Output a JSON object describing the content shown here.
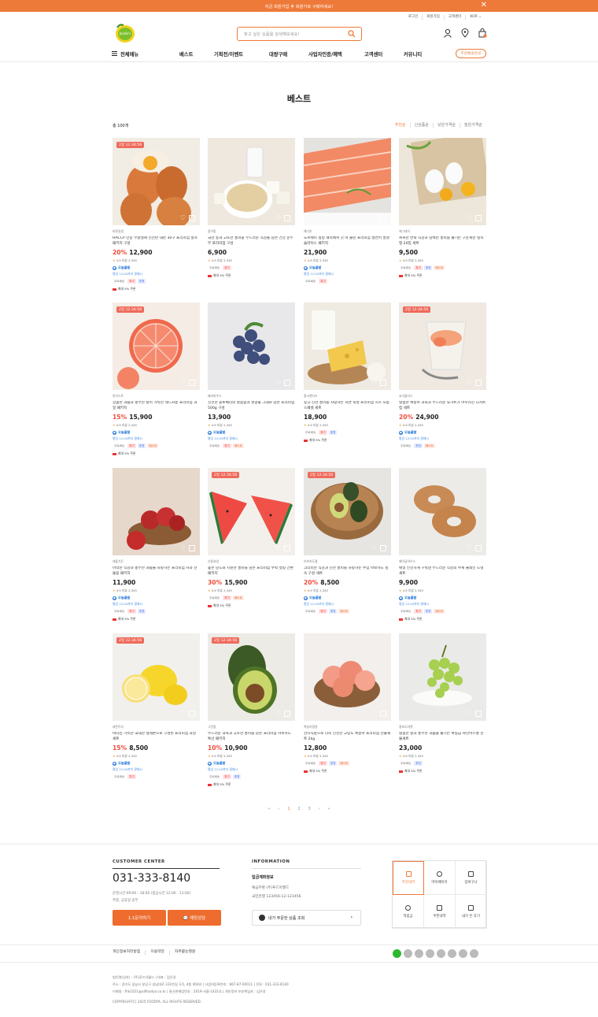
{
  "topbar": {
    "message": "지금 회원가입 후 회원가로 구매하세요!",
    "close": "✕"
  },
  "util": [
    "로그인",
    "회원가입",
    "고객센터",
    "KOR ⌄"
  ],
  "logo": {
    "text": "Jooda's Farm"
  },
  "search": {
    "placeholder": "찾고 싶은 상품을 검색해보세요!"
  },
  "nav": {
    "all_menu": "전체메뉴",
    "items": [
      "베스트",
      "기획전/이벤트",
      "대량구매",
      "사업자인증/혜택",
      "고객센터",
      "커뮤니티"
    ],
    "guide": "주문배송안내"
  },
  "page": {
    "title": "베스트",
    "count": "총 100개"
  },
  "sorts": [
    "추천순",
    "신상품순",
    "낮은가격순",
    "높은가격순"
  ],
  "labels": {
    "today": "오늘출발",
    "ship": "평일 12:00까지 결제시",
    "free": "무료배송",
    "special": "특가",
    "recommend": "추천",
    "best": "베스트",
    "coupon": "최대 5% 쿠폰"
  },
  "colors": {
    "accent": "#ee7a3a",
    "discount": "#ef4c3a",
    "timer": "#ef6a5b",
    "today": "#1e73d8"
  },
  "products": [
    {
      "timer": "2일 12:34:56",
      "brand": "바른달걀",
      "name": "HACCP 인증 무항생제 신선란 대란 30구 프리미엄 실속 패키지 구성",
      "discount": "20%",
      "price": "12,900",
      "rating": "4.9",
      "reviews": "리뷰 2,345",
      "today": true,
      "tags": [
        "free",
        "tk",
        "tc"
      ],
      "coupon": true,
      "img": "eggs"
    },
    {
      "timer": "",
      "brand": "콩이랑",
      "name": "국산 콩과 고소한 풍미를 부드러운 식감을 담은 건강 순두부 프리미엄 구성",
      "discount": "",
      "price": "6,900",
      "rating": "4.9",
      "reviews": "리뷰 2,345",
      "today": false,
      "tags": [
        "free",
        "tk"
      ],
      "coupon": true,
      "img": "soy"
    },
    {
      "timer": "",
      "brand": "해다온",
      "name": "노르웨이 청정 해역에서 갓 어 올린 프리미엄 생연어 필렛 슬라이스 패키지",
      "discount": "",
      "price": "21,900",
      "rating": "4.9",
      "reviews": "리뷰 2,345",
      "today": true,
      "tags": [
        "free",
        "tk"
      ],
      "coupon": false,
      "img": "salmon"
    },
    {
      "timer": "",
      "brand": "에그데이",
      "name": "촉촉한 반숙 식감과 담백한 풍미를 즐기는 구운계란 실속형 20입 세트",
      "discount": "",
      "price": "9,500",
      "rating": "4.9",
      "reviews": "리뷰 2,345",
      "today": false,
      "tags": [
        "free",
        "tk",
        "tc",
        "tb"
      ],
      "coupon": true,
      "img": "boiled"
    },
    {
      "timer": "2일 12:34:56",
      "brand": "썬키스트",
      "name": "상큼한 과즙과 풍부한 향이 가득한 레드자몽 프리미엄 과일 패키지",
      "discount": "15%",
      "price": "15,900",
      "rating": "4.9",
      "reviews": "리뷰 2,345",
      "today": true,
      "tags": [
        "free",
        "tk",
        "tc",
        "tb"
      ],
      "coupon": true,
      "img": "grapefruit"
    },
    {
      "timer": "",
      "brand": "베리파우스",
      "name": "신선한 블루베리의 달콤함과 영양을 그대로 담은 프리미엄 500g 구성",
      "discount": "",
      "price": "13,900",
      "rating": "4.9",
      "reviews": "리뷰 2,345",
      "today": true,
      "tags": [
        "free",
        "tk",
        "tb"
      ],
      "coupon": false,
      "img": "blueberry"
    },
    {
      "timer": "",
      "brand": "밀크앤치즈",
      "name": "깊고 진한 풍미를 자랑하는 자연 숙성 프리미엄 치즈 모둠 스페셜 세트",
      "discount": "",
      "price": "18,900",
      "rating": "4.9",
      "reviews": "리뷰 2,345",
      "today": false,
      "tags": [
        "free",
        "tk",
        "tc"
      ],
      "coupon": true,
      "img": "cheese"
    },
    {
      "timer": "2일 12:34:56",
      "brand": "요거플러스",
      "name": "달콤한 복숭아 과육과 부드러운 요거트가 어우러진 디저트 컵 세트",
      "discount": "20%",
      "price": "24,900",
      "rating": "4.9",
      "reviews": "리뷰 2,345",
      "today": true,
      "tags": [
        "free",
        "tc",
        "tb"
      ],
      "coupon": false,
      "img": "yogurt"
    },
    {
      "timer": "",
      "brand": "애플가든",
      "name": "아삭한 식감과 풍부한 과즙을 자랑하는 프리미엄 사과 선물용 패키지",
      "discount": "",
      "price": "11,900",
      "rating": "4.9",
      "reviews": "리뷰 2,345",
      "today": true,
      "tags": [
        "free",
        "tk",
        "tc"
      ],
      "coupon": true,
      "img": "apple"
    },
    {
      "timer": "2일 12:34:56",
      "brand": "산들과일",
      "name": "높은 당도와 시원한 풍미를 담은 프리미엄 수박 컷팅 간편 패키지",
      "discount": "30%",
      "price": "15,900",
      "rating": "4.9",
      "reviews": "리뷰 2,345",
      "today": false,
      "tags": [
        "free",
        "tk",
        "tb"
      ],
      "coupon": true,
      "img": "watermelon"
    },
    {
      "timer": "2일 12:34:56",
      "brand": "아보카도랩",
      "name": "크리미한 식감과 진한 풍미를 자랑하는 수입 아보카도 실속 구성 세트",
      "discount": "20%",
      "price": "8,500",
      "rating": "4.9",
      "reviews": "리뷰 2,345",
      "today": true,
      "tags": [
        "free",
        "tk",
        "tc",
        "tb"
      ],
      "coupon": false,
      "img": "avocado"
    },
    {
      "timer": "",
      "brand": "베이글하우스",
      "name": "매일 신선하게 구워낸 부드러운 식감의 수제 플레인 도넛 세트",
      "discount": "",
      "price": "9,900",
      "rating": "4.9",
      "reviews": "리뷰 2,345",
      "today": true,
      "tags": [
        "free",
        "tk",
        "tc",
        "tb"
      ],
      "coupon": true,
      "img": "bagel"
    },
    {
      "timer": "2일 12:34:56",
      "brand": "레몬트리",
      "name": "비타민 가득한 국내산 생레몬으로 구성된 프리미엄 과일 세트",
      "discount": "15%",
      "price": "8,500",
      "rating": "4.9",
      "reviews": "리뷰 2,345",
      "today": true,
      "tags": [
        "free",
        "tk"
      ],
      "coupon": false,
      "img": "lemon"
    },
    {
      "timer": "2일 12:34:56",
      "brand": "그린팜",
      "name": "부드러운 과육과 고소한 풍미를 담은 프리미엄 아보카도 특선 패키지",
      "discount": "10%",
      "price": "10,900",
      "rating": "4.9",
      "reviews": "리뷰 2,345",
      "today": true,
      "tags": [
        "free",
        "tk",
        "tc"
      ],
      "coupon": true,
      "img": "avocado2"
    },
    {
      "timer": "",
      "brand": "복숭아정원",
      "name": "산지직송으로 더욱 신선한 고당도 복숭아 프리미엄 선물세트 2kg",
      "discount": "",
      "price": "12,800",
      "rating": "4.9",
      "reviews": "리뷰 2,345",
      "today": false,
      "tags": [
        "free",
        "tk",
        "tc",
        "tb"
      ],
      "coupon": true,
      "img": "peach"
    },
    {
      "timer": "",
      "brand": "청포도마켓",
      "name": "달콤한 향과 풍부한 과즙을 즐기는 특등급 샤인머스켓 선물세트",
      "discount": "",
      "price": "23,000",
      "rating": "4.9",
      "reviews": "리뷰 2,345",
      "today": false,
      "tags": [
        "free",
        "tc"
      ],
      "coupon": true,
      "img": "grape"
    }
  ],
  "paging": {
    "first": "«",
    "prev": "‹",
    "pages": [
      "1",
      "2",
      "3"
    ],
    "next": "›",
    "last": "»"
  },
  "footer": {
    "cc_title": "CUSTOMER CENTER",
    "phone": "031-333-8140",
    "hours1": "운영시간 09:00 - 18:00 (점심시간 12:00 - 13:00)",
    "hours2": "주말, 공휴일 휴무",
    "btn1": "1:1문의하기",
    "btn2": "💬 채팅상담",
    "info_title": "INFORMATION",
    "bank_title": "입금계좌정보",
    "acc1": "예금주명   (주)푸드아월드",
    "acc2": "국민은행   123456-12-123456",
    "lookup": "내가 주문한 상품 조회",
    "grid": [
      "주문내역",
      "마이페이지",
      "장바구니",
      "적립금",
      "쿠폰내역",
      "내가 쓴 후기"
    ],
    "links": [
      "개인정보처리방침",
      "이용약관",
      "자주묻는질문"
    ],
    "corp1": "법인명(상호) : (주)푸드아월드   |   대표 : 김은경",
    "corp2": "주소 : 경기도 성남시 분당구 성남대로 331번길 3-5, 4층 404호   |   사업자등록번호 : 867-87-00011   |   전화 : 031-333-8140",
    "corp3": "이메일 : fhk1021@allfoodya.co.kr   |   통신판매업번호 : 2019-서울-1431호   |   개인정보 보호책임자 : 김은경",
    "copyright": "COPYRIGHT(C) 2025 FOODYA. ALL RIGHTS RESERVED."
  }
}
